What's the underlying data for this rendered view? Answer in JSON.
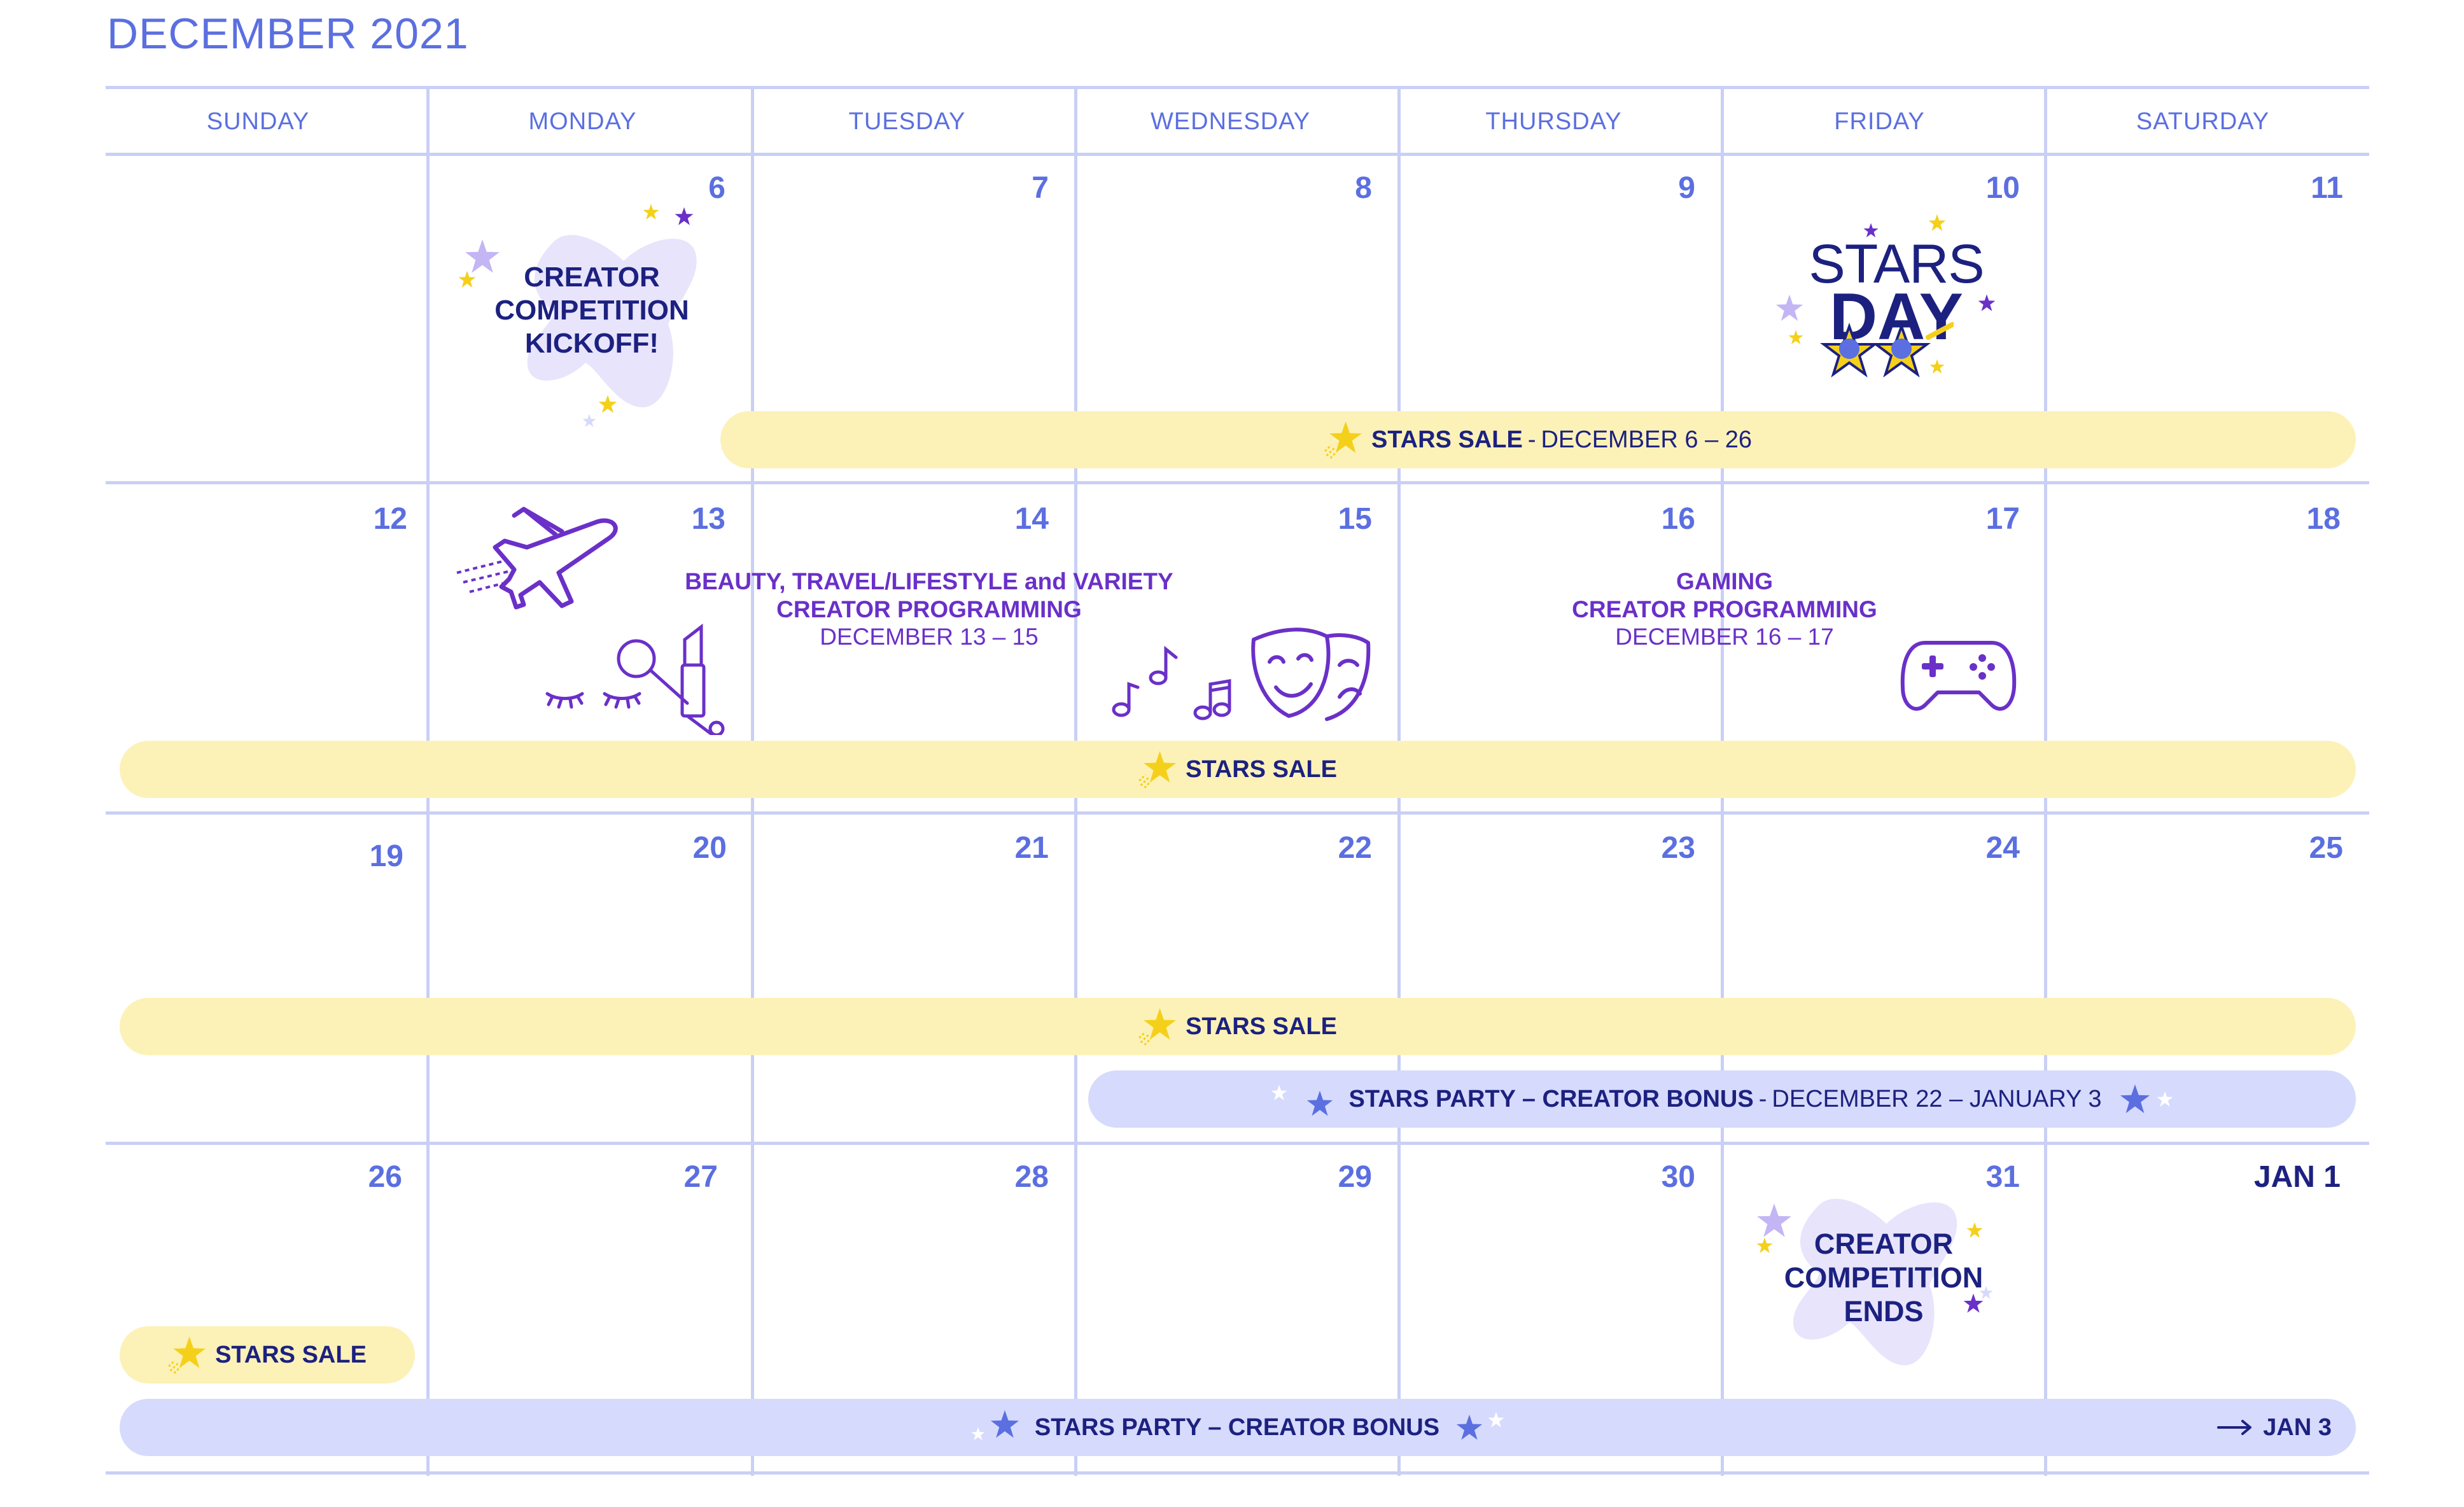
{
  "calendar": {
    "title": "DECEMBER 2021",
    "day_names": [
      "SUNDAY",
      "MONDAY",
      "TUESDAY",
      "WEDNESDAY",
      "THURSDAY",
      "FRIDAY",
      "SATURDAY"
    ],
    "week1": [
      "6",
      "7",
      "8",
      "9",
      "10",
      "11"
    ],
    "week2": [
      "12",
      "13",
      "14",
      "15",
      "16",
      "17",
      "18"
    ],
    "week3": [
      "19",
      "20",
      "21",
      "22",
      "23",
      "24",
      "25"
    ],
    "week4": [
      "26",
      "27",
      "28",
      "29",
      "30",
      "31",
      "JAN 1"
    ]
  },
  "events": {
    "kickoff": [
      "CREATOR",
      "COMPETITION",
      "KICKOFF!"
    ],
    "stars_day_line1": "STARS",
    "stars_day_line2": "DAY",
    "beauty_title_1": "BEAUTY, TRAVEL/LIFESTYLE and VARIETY",
    "beauty_title_2": "CREATOR PROGRAMMING",
    "beauty_dates": "DECEMBER 13 – 15",
    "gaming_title_1": "GAMING",
    "gaming_title_2": "CREATOR PROGRAMMING",
    "gaming_dates": "DECEMBER 16 – 17",
    "ends": [
      "CREATOR",
      "COMPETITION",
      "ENDS"
    ]
  },
  "bars": {
    "sale1_label": "STARS SALE",
    "sale1_dates": "DECEMBER 6 – 26",
    "sale_label": "STARS SALE",
    "party_label": "STARS PARTY – CREATOR BONUS",
    "party_dates": "DECEMBER 22 – JANUARY 3",
    "party_end": "JAN 3"
  },
  "icons": [
    "star-icon",
    "airplane-icon",
    "lipstick-icon",
    "makeup-brush-icon",
    "eyelash-icon",
    "music-notes-icon",
    "theater-masks-icon",
    "game-controller-icon",
    "arrow-right-icon",
    "star-glasses-icon"
  ],
  "colors": {
    "accent": "#5b6fe0",
    "navy": "#1c2180",
    "purple": "#6a30c8",
    "yellow_bar": "#fcf2b8",
    "blue_bar": "#d6dafc",
    "grid": "#c9cff5",
    "star_yellow": "#f5d01b"
  }
}
